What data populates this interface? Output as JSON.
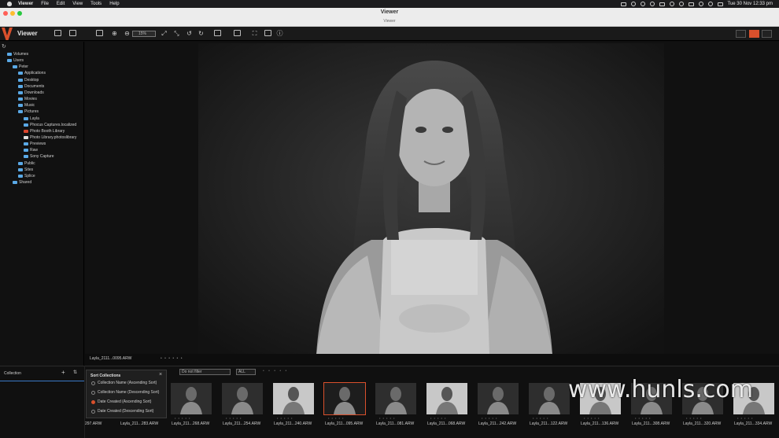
{
  "menubar": {
    "app": "Viewer",
    "items": [
      "File",
      "Edit",
      "View",
      "Tools",
      "Help"
    ],
    "clock": "Tue 30 Nov  12:33 pm"
  },
  "window": {
    "title": "Viewer",
    "subtitle": "Viewer"
  },
  "toolbar": {
    "app_name": "Viewer",
    "zoom": "15%"
  },
  "sidebar": {
    "items": [
      {
        "label": "Volumes",
        "depth": 0,
        "color": "blue"
      },
      {
        "label": "Users",
        "depth": 0,
        "color": "blue"
      },
      {
        "label": "Peter",
        "depth": 1,
        "color": "blue"
      },
      {
        "label": "Applications",
        "depth": 2,
        "color": "blue"
      },
      {
        "label": "Desktop",
        "depth": 2,
        "color": "blue"
      },
      {
        "label": "Documents",
        "depth": 2,
        "color": "blue"
      },
      {
        "label": "Downloads",
        "depth": 2,
        "color": "blue"
      },
      {
        "label": "Movies",
        "depth": 2,
        "color": "blue"
      },
      {
        "label": "Music",
        "depth": 2,
        "color": "blue"
      },
      {
        "label": "Pictures",
        "depth": 2,
        "color": "blue"
      },
      {
        "label": "Layla",
        "depth": 3,
        "color": "blue"
      },
      {
        "label": "Phocus Captures.localized",
        "depth": 3,
        "color": "blue"
      },
      {
        "label": "Photo Booth Library",
        "depth": 3,
        "color": "red"
      },
      {
        "label": "Photo Library.photoslibrary",
        "depth": 3,
        "color": "white"
      },
      {
        "label": "Previews",
        "depth": 3,
        "color": "blue"
      },
      {
        "label": "Raw",
        "depth": 3,
        "color": "blue"
      },
      {
        "label": "Sony Capture",
        "depth": 3,
        "color": "blue"
      },
      {
        "label": "Public",
        "depth": 2,
        "color": "blue"
      },
      {
        "label": "Sites",
        "depth": 2,
        "color": "blue"
      },
      {
        "label": "Splice",
        "depth": 2,
        "color": "blue"
      },
      {
        "label": "Shared",
        "depth": 1,
        "color": "blue"
      }
    ]
  },
  "viewer": {
    "caption": "Layla_2111...0095.ARW"
  },
  "collection": {
    "label": "Collection"
  },
  "filter": {
    "mode": "Do not filter",
    "scope": "ALL"
  },
  "sort_popup": {
    "title": "Sort Collections",
    "options": [
      {
        "label": "Collection Name (Ascending Sort)",
        "selected": false
      },
      {
        "label": "Collection Name (Descending Sort)",
        "selected": false
      },
      {
        "label": "Date Created (Ascending Sort)",
        "selected": true
      },
      {
        "label": "Date Created (Descending Sort)",
        "selected": false
      }
    ]
  },
  "filmstrip": [
    {
      "label": "297.ARW"
    },
    {
      "label": "Layla_211...283.ARW"
    },
    {
      "label": "Layla_211...268.ARW"
    },
    {
      "label": "Layla_211...254.ARW"
    },
    {
      "label": "Layla_211...240.ARW"
    },
    {
      "label": "Layla_211...095.ARW",
      "selected": true
    },
    {
      "label": "Layla_211...081.ARW"
    },
    {
      "label": "Layla_211...068.ARW"
    },
    {
      "label": "Layla_211...242.ARW"
    },
    {
      "label": "Layla_211...122.ARW"
    },
    {
      "label": "Layla_211...136.ARW"
    },
    {
      "label": "Layla_211...308.ARW"
    },
    {
      "label": "Layla_211...320.ARW"
    },
    {
      "label": "Layla_211...334.ARW"
    }
  ],
  "watermark": "www.hunls.com"
}
